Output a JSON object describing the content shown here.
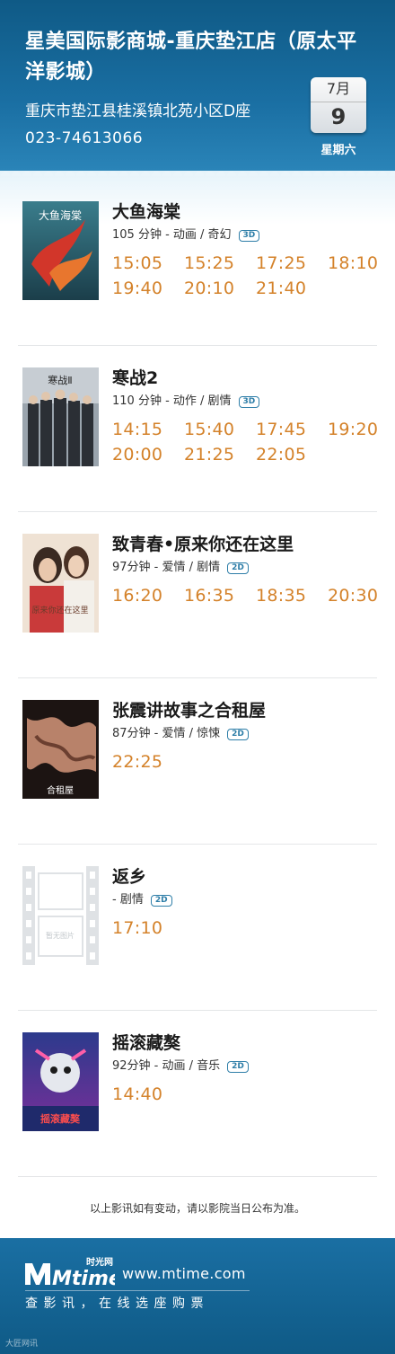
{
  "header": {
    "cinema_name": "星美国际影商城-重庆垫江店（原太平洋影城）",
    "address": "重庆市垫江县桂溪镇北苑小区D座",
    "phone": "023-74613066",
    "date": {
      "month": "7月",
      "day": "9",
      "weekday": "星期六"
    }
  },
  "movies": [
    {
      "title": "大鱼海棠",
      "meta": "105 分钟 - 动画 / 奇幻",
      "format": "3D",
      "poster_caption": "大鱼海棠",
      "times": [
        "15:05",
        "15:25",
        "17:25",
        "18:10",
        "19:40",
        "20:10",
        "21:40"
      ]
    },
    {
      "title": "寒战2",
      "meta": "110 分钟 - 动作 / 剧情",
      "format": "3D",
      "poster_caption": "寒战Ⅱ",
      "times": [
        "14:15",
        "15:40",
        "17:45",
        "19:20",
        "20:00",
        "21:25",
        "22:05"
      ]
    },
    {
      "title": "致青春•原来你还在这里",
      "meta": "97分钟 - 爱情 / 剧情",
      "format": "2D",
      "poster_caption": "原来你还在这里",
      "times": [
        "16:20",
        "16:35",
        "18:35",
        "20:30"
      ]
    },
    {
      "title": "张震讲故事之合租屋",
      "meta": "87分钟 - 爱情 / 惊悚",
      "format": "2D",
      "poster_caption": "合租屋",
      "times": [
        "22:25"
      ]
    },
    {
      "title": "返乡",
      "meta": " - 剧情",
      "format": "2D",
      "poster_caption": "暂无图片",
      "times": [
        "17:10"
      ]
    },
    {
      "title": "摇滚藏獒",
      "meta": "92分钟 - 动画 / 音乐",
      "format": "2D",
      "poster_caption": "摇滚藏獒",
      "times": [
        "14:40"
      ]
    }
  ],
  "note": "以上影讯如有变动，请以影院当日公布为准。",
  "footer": {
    "logo_text": "Mtime",
    "logo_cn": "时光网",
    "url": "www.mtime.com",
    "slogan": "查影讯，在线选座购票",
    "watermark": "大匠网讯"
  },
  "colors": {
    "header_blue": "#1a6fa3",
    "time_orange": "#d4822a",
    "badge_blue": "#2e7ea8"
  }
}
